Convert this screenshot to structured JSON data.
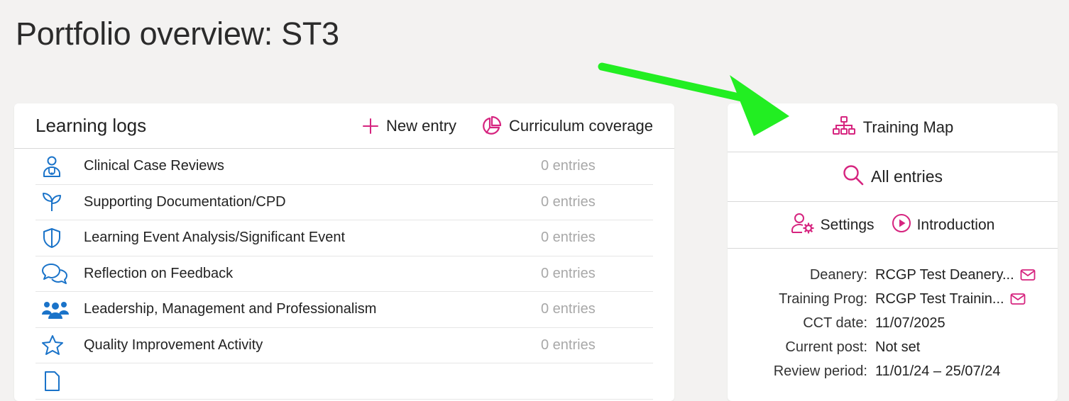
{
  "page": {
    "title": "Portfolio overview: ST3"
  },
  "learning_logs": {
    "title": "Learning logs",
    "new_entry_label": "New entry",
    "curriculum_label": "Curriculum coverage",
    "items": [
      {
        "icon": "doctor-icon",
        "label": "Clinical Case Reviews",
        "count": "0 entries"
      },
      {
        "icon": "sprout-icon",
        "label": "Supporting Documentation/CPD",
        "count": "0 entries"
      },
      {
        "icon": "shield-icon",
        "label": "Learning Event Analysis/Significant Event",
        "count": "0 entries"
      },
      {
        "icon": "chat-bubbles-icon",
        "label": "Reflection on Feedback",
        "count": "0 entries"
      },
      {
        "icon": "group-icon",
        "label": "Leadership, Management and Professionalism",
        "count": "0 entries"
      },
      {
        "icon": "star-icon",
        "label": "Quality Improvement Activity",
        "count": "0 entries"
      }
    ]
  },
  "side": {
    "training_map_label": "Training Map",
    "all_entries_label": "All entries",
    "settings_label": "Settings",
    "introduction_label": "Introduction",
    "info": [
      {
        "key": "Deanery:",
        "value": "RCGP Test Deanery...",
        "mail": true
      },
      {
        "key": "Training Prog:",
        "value": "RCGP Test Trainin...",
        "mail": true
      },
      {
        "key": "CCT date:",
        "value": "11/07/2025",
        "mail": false
      },
      {
        "key": "Current post:",
        "value": "Not set",
        "mail": false
      },
      {
        "key": "Review period:",
        "value": "11/01/24 – 25/07/24",
        "mail": false
      }
    ]
  },
  "colors": {
    "accent": "#d6247f",
    "icon_blue": "#1a73c9",
    "arrow": "#22ee22"
  }
}
